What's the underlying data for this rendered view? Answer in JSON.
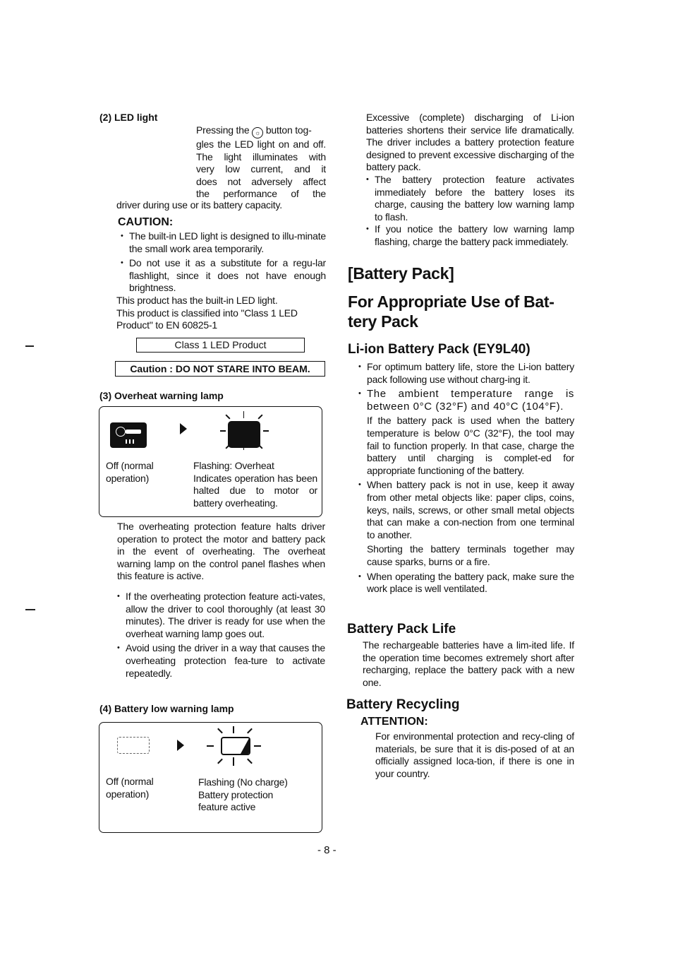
{
  "left_column": {
    "led_light": {
      "heading": "(2) LED light",
      "intro_lines": [
        "Pressing the",
        "button tog-",
        "gles the LED light on and off.",
        "The light illuminates with",
        "very low current, and it",
        "does not adversely affect",
        "the performance of the"
      ],
      "intro_tail": "driver during use or its battery capacity.",
      "button_icon": "led-light-button-icon",
      "caution_heading": "CAUTION:",
      "caution_items": [
        "The built-in LED light is designed to illu-minate the small work area temporarily.",
        "Do not use it as a substitute for a regu-lar flashlight, since it does not have enough brightness."
      ],
      "product_note_1": "This product has the built-in LED light.",
      "product_note_2": "This product is classified into \"Class 1 LED Product\" to EN 60825-1",
      "class_label": "Class 1 LED Product",
      "caution_label": "Caution : DO NOT STARE INTO BEAM."
    },
    "overheat_lamp": {
      "heading": "(3) Overheat warning lamp",
      "off_label": "Off (normal operation)",
      "flashing_label": "Flashing: Overheat",
      "flashing_desc": "Indicates operation has been halted due to motor or battery overheating.",
      "description": "The overheating protection feature halts driver operation to protect the motor and battery pack in the event of overheating. The overheat warning lamp on the control panel flashes when this feature is active.",
      "bullets": [
        "If the overheating protection feature acti-vates, allow the driver to cool thoroughly (at least 30 minutes). The driver is ready for use when the overheat warning lamp goes out.",
        "Avoid using the driver in a way that causes the overheating protection fea-ture to activate repeatedly."
      ]
    },
    "battery_low_lamp": {
      "heading": "(4) Battery low warning lamp",
      "off_label": "Off (normal operation)",
      "flashing_label": "Flashing (No charge)",
      "flashing_desc": "Battery protection feature active"
    }
  },
  "right_column": {
    "discharge_text": "Excessive (complete) discharging of Li-ion batteries shortens their service life dramatically. The driver includes a battery protection feature designed to prevent excessive discharging of the battery pack.",
    "discharge_bullets": [
      "The battery protection feature activates immediately before the battery loses its charge, causing the battery low warning lamp to flash.",
      "If you notice the battery low warning lamp flashing, charge the battery pack immediately."
    ],
    "section_title": "[Battery Pack]",
    "appropriate_use_title": "For Appropriate Use of Bat-tery Pack",
    "liion_heading": "Li-ion Battery Pack (EY9L40)",
    "liion_bullets": [
      "For optimum battery life, store the Li-ion battery pack following use without charg-ing it.",
      "The ambient temperature range is between 0°C (32°F) and 40°C (104°F)."
    ],
    "temperature_note": "If the battery pack is used when the battery temperature is below 0°C (32°F), the tool may fail to function properly. In that case, charge the battery until charging is complet-ed for appropriate functioning of the battery.",
    "metal_bullet": "When battery pack is not in use, keep it away from other metal objects like: paper clips, coins, keys, nails, screws, or other small metal objects that can make a con-nection from one terminal to another.",
    "shorting_note": "Shorting the battery terminals together may cause sparks, burns or a fire.",
    "ventilation_bullet": "When operating the battery pack, make sure the work place is well ventilated.",
    "life_heading": "Battery Pack Life",
    "life_text": "The rechargeable batteries have a lim-ited life. If the operation time becomes extremely short after recharging, replace the battery pack with a new one.",
    "recycling_heading": "Battery Recycling",
    "attention_heading": "ATTENTION:",
    "recycling_text": "For environmental protection and recy-cling of materials, be sure that it is dis-posed of at an officially assigned loca-tion, if there is one in your country."
  },
  "page_number": "- 8 -"
}
